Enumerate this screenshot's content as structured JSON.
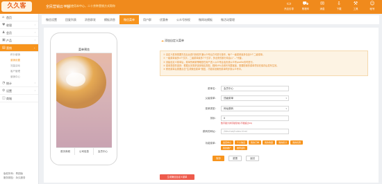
{
  "header": {
    "logo": "久久客",
    "brand": "全民营销云平台",
    "notice": "欢迎使用本中心，二十余种营销方式帮你",
    "icons": [
      {
        "label": "开店引导",
        "icon": "monitor-icon"
      },
      {
        "label": "购物车",
        "icon": "cart-icon"
      },
      {
        "label": "消息",
        "icon": "message-icon"
      },
      {
        "label": "下载",
        "icon": "download-icon"
      },
      {
        "label": "工具",
        "icon": "tool-icon"
      },
      {
        "label": "帐号",
        "icon": "user-icon"
      }
    ]
  },
  "sidebar": {
    "items": [
      {
        "label": "首页",
        "icon": "home-icon"
      },
      {
        "label": "收银",
        "icon": "heart-icon"
      },
      {
        "label": "会员",
        "icon": "people-icon"
      },
      {
        "label": "产品",
        "icon": "box-icon"
      },
      {
        "label": "营销",
        "icon": "chart-icon",
        "active": true
      }
    ],
    "subitems": [
      {
        "label": "积分营销"
      },
      {
        "label": "营销设置",
        "active": true
      },
      {
        "label": "流量活动"
      },
      {
        "label": "客户管理"
      },
      {
        "label": "营销中心"
      }
    ],
    "items_bottom": [
      {
        "label": "统计",
        "icon": "stats-icon"
      },
      {
        "label": "设置",
        "icon": "settings-icon"
      },
      {
        "label": "商城",
        "icon": "store-icon"
      }
    ],
    "footer": {
      "line1": "版权所有：青铜版",
      "line2": "服务期至：永久服务"
    }
  },
  "tabs": [
    "微信设置",
    "回复列表",
    "消息群发",
    "模板消息",
    "微信菜单",
    "用户群",
    "优惠券",
    "公众号授权",
    "微网站模板",
    "微活动管理"
  ],
  "active_tab": 4,
  "phone": {
    "title": "菜单预览",
    "menu": [
      "首页商城",
      "公司信息",
      "会员中心"
    ]
  },
  "form": {
    "title": "添加自定义菜单",
    "tips": [
      "① 自定义菜单需要先在后台进行授权开通公众号后方可进行操作，每个一级菜单最多包含5个二级菜单。",
      "② 一级菜单最多4个汉字，二级菜单最多7个汉字，多出来的部分将会以\"...\"代替。",
      "③ 创建自定义菜单后，菜单的刷新策略是在用户进入公众号会话页或公众号profile页时进行。",
      "④ 菜单类型的选择：根据业务需求选择相应类型。跳转URL请填写完整链接，需要配置的菜单项请在保存后发布生效。",
      "⑤ 修改菜单后需要点击\"生成微信菜单\"按钮，才能将设置的菜单同步到公众号中。"
    ],
    "fields": [
      {
        "label": "菜单名：",
        "value": "会员中心",
        "placeholder": false
      },
      {
        "label": "父级菜单：",
        "value": "顶级菜单",
        "placeholder": false,
        "dropdown": true
      },
      {
        "label": "菜单类型：",
        "value": "网址跳转",
        "placeholder": false,
        "dropdown": true
      },
      {
        "label": "排序：",
        "value": "0",
        "placeholder": false
      },
      {
        "label": "跳转的网址：",
        "value": "/Wechat/Index.html",
        "placeholder": true
      }
    ],
    "sort_help": "数字越大排序越靠前(不能超过99)",
    "actions_label": "功能菜单：",
    "actions": [
      "会员中心",
      "个人信息",
      "我的订单",
      "我的收藏",
      "我的积分",
      "我的优惠",
      "我的推广",
      "推荐返利"
    ],
    "buttons": {
      "save": "保存",
      "reset": "重置",
      "back": "返回"
    },
    "generate": "生成微信自定义菜单"
  }
}
